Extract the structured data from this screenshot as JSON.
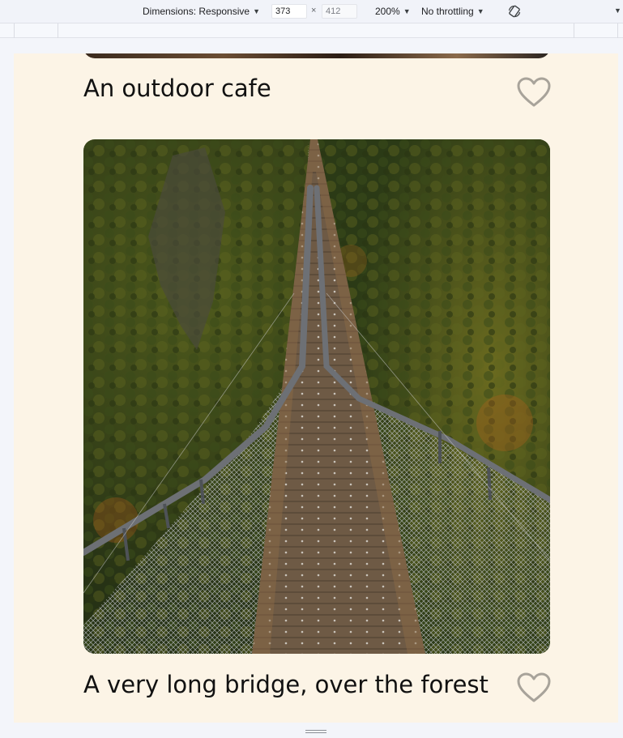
{
  "devtools": {
    "dimensions_label": "Dimensions: Responsive",
    "width_value": "373",
    "height_value": "412",
    "times": "×",
    "zoom_label": "200%",
    "throttling_label": "No throttling",
    "caret": "▼",
    "rotate_icon": "rotate-icon"
  },
  "gallery": {
    "cards": [
      {
        "title": "An outdoor cafe",
        "liked": false,
        "image": "outdoor-cafe-photo"
      },
      {
        "title": "A very long bridge, over the forest",
        "liked": false,
        "image": "suspension-bridge-forest-photo"
      }
    ]
  },
  "colors": {
    "page_background": "#fcf4e6",
    "heart_stroke": "#a8a39a",
    "title_text": "#111111"
  }
}
